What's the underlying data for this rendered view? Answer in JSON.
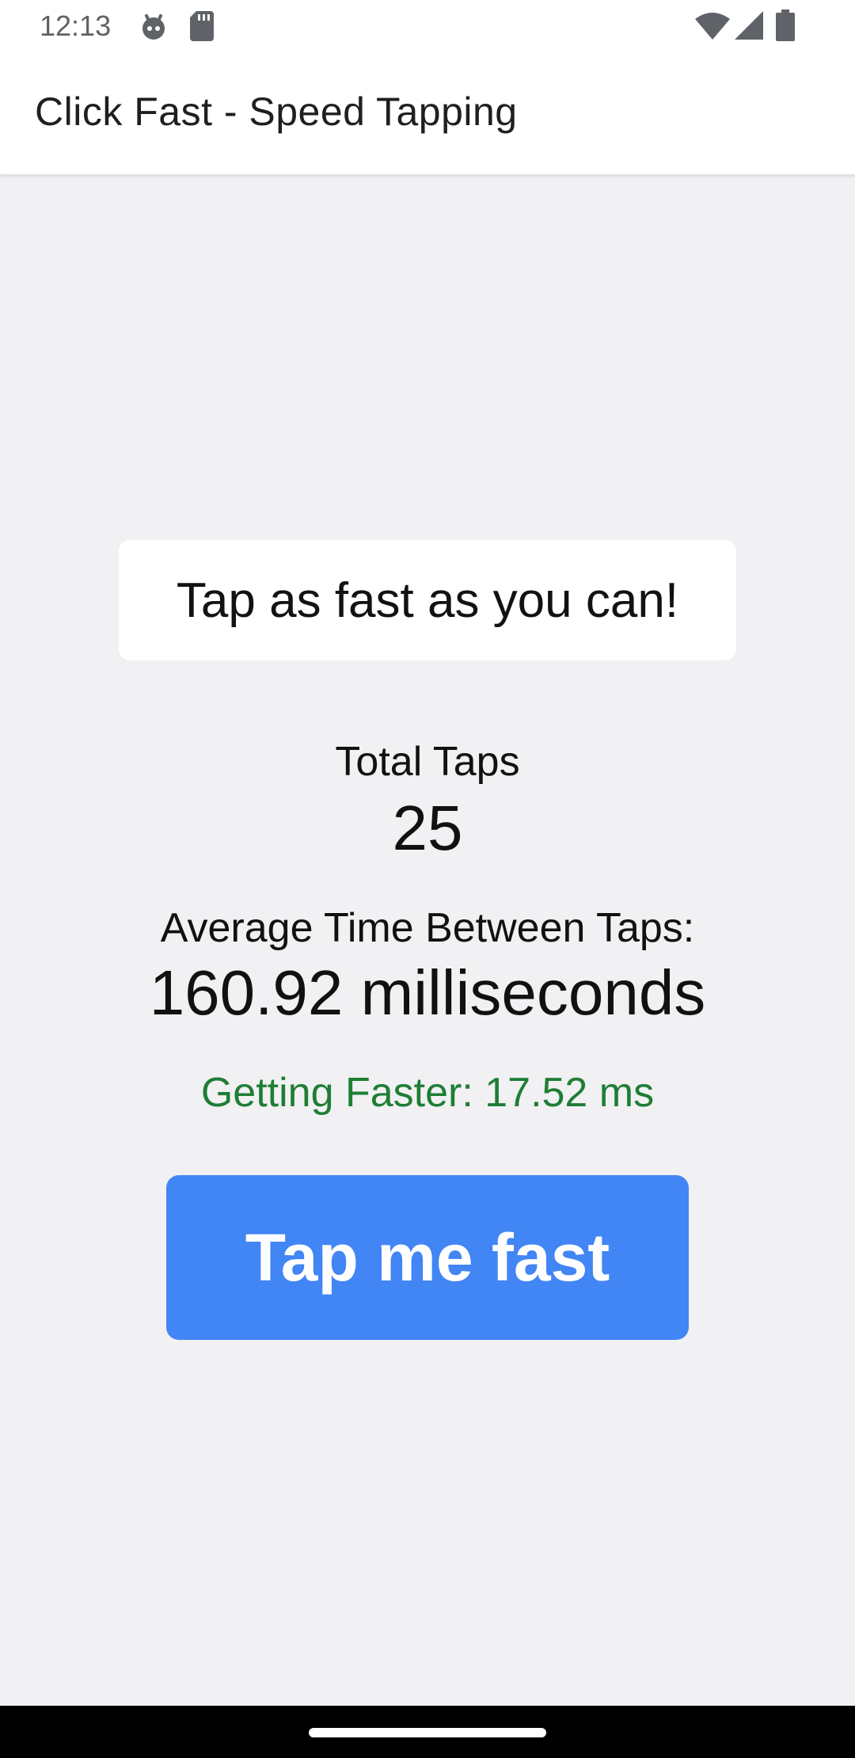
{
  "status_bar": {
    "time": "12:13",
    "icons": [
      "android-debug-icon",
      "sd-card-icon",
      "wifi-icon",
      "cell-signal-icon",
      "battery-icon"
    ]
  },
  "app_bar": {
    "title": "Click Fast - Speed Tapping"
  },
  "main": {
    "prompt": "Tap as fast as you can!",
    "total_taps_label": "Total Taps",
    "total_taps_value": "25",
    "average_label": "Average Time Between Taps:",
    "average_value": "160.92 milliseconds",
    "trend_text": "Getting Faster: 17.52 ms",
    "tap_button_label": "Tap me fast"
  },
  "colors": {
    "background": "#f1f0f3",
    "button": "#4285f4",
    "trend_text": "#1e7e34",
    "app_bar": "#ffffff"
  }
}
